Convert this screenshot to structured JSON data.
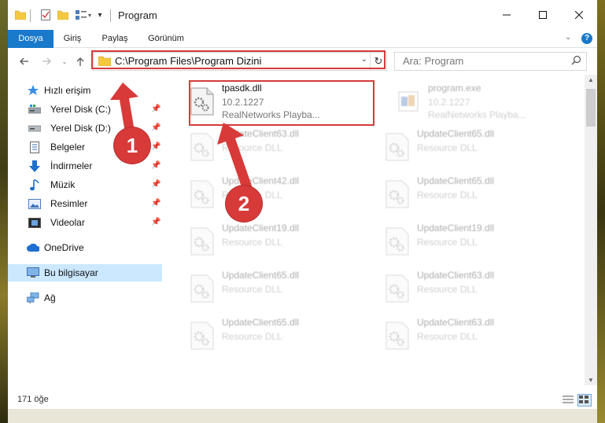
{
  "window": {
    "title": "Program"
  },
  "ribbon": {
    "tabs": [
      {
        "label": "Dosya",
        "active": true
      },
      {
        "label": "Giriş"
      },
      {
        "label": "Paylaş"
      },
      {
        "label": "Görünüm"
      }
    ],
    "help_label": "?"
  },
  "navigation": {
    "address_path": "C:\\Program Files\\Program Dizini",
    "search_placeholder": "Ara: Program"
  },
  "sidebar": {
    "items": [
      {
        "label": "Hızlı erişim",
        "icon": "star-icon"
      },
      {
        "label": "Yerel Disk (C:)",
        "icon": "drive-icon",
        "pinned": true
      },
      {
        "label": "Yerel Disk (D:)",
        "icon": "drive-icon",
        "pinned": true
      },
      {
        "label": "Belgeler",
        "icon": "documents-icon",
        "pinned": true
      },
      {
        "label": "İndirmeler",
        "icon": "download-icon",
        "pinned": true
      },
      {
        "label": "Müzik",
        "icon": "music-icon",
        "pinned": true
      },
      {
        "label": "Resimler",
        "icon": "pictures-icon",
        "pinned": true
      },
      {
        "label": "Videolar",
        "icon": "videos-icon",
        "pinned": true
      },
      {
        "label": "OneDrive",
        "icon": "cloud-icon"
      },
      {
        "label": "Bu bilgisayar",
        "icon": "computer-icon",
        "selected": true
      },
      {
        "label": "Ağ",
        "icon": "network-icon"
      }
    ]
  },
  "files": [
    {
      "name": "tpasdk.dll",
      "line1": "10.2.1227",
      "line2": "RealNetworks Playba...",
      "highlighted": true
    },
    {
      "name": "program.exe",
      "line1": "10.2.1227",
      "line2": "RealNetworks Playba..."
    },
    {
      "name": "UpdateClient63.dll",
      "line1": "Resource DLL"
    },
    {
      "name": "UpdateClient65.dll",
      "line1": "Resource DLL"
    },
    {
      "name": "UpdateClient42.dll",
      "line1": "Resource DLL"
    },
    {
      "name": "UpdateClient65.dll",
      "line1": "Resource DLL"
    },
    {
      "name": "UpdateClient19.dll",
      "line1": "Resource DLL"
    },
    {
      "name": "UpdateClient19.dll",
      "line1": "Resource DLL"
    },
    {
      "name": "UpdateClient65.dll",
      "line1": "Resource DLL"
    },
    {
      "name": "UpdateClient63.dll",
      "line1": "Resource DLL"
    },
    {
      "name": "UpdateClient65.dll",
      "line1": "Resource DLL"
    },
    {
      "name": "UpdateClient63.dll",
      "line1": "Resource DLL"
    }
  ],
  "status": {
    "item_count": "171 öğe"
  },
  "annotations": {
    "step1": "1",
    "step2": "2",
    "color": "#d83a3a"
  },
  "colors": {
    "accent": "#1979ca",
    "selection": "#cce8ff",
    "highlight_border": "#d53b3b"
  }
}
